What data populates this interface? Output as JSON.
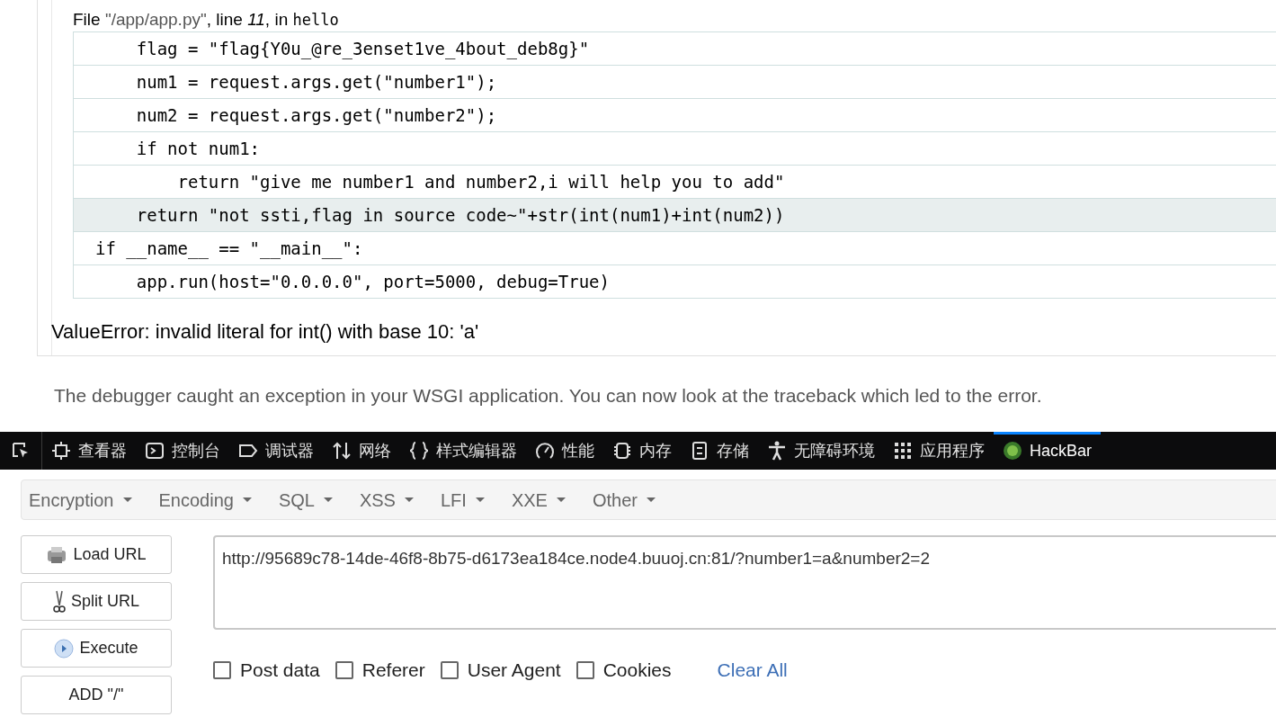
{
  "traceback": {
    "file_line": {
      "prefix": "File ",
      "path": "\"/app/app.py\"",
      "mid": ", line ",
      "line": "11",
      "sep": ", in ",
      "func": "hello"
    },
    "code_lines": [
      {
        "text": "    flag = \"flag{Y0u_@re_3enset1ve_4bout_deb8g}\"",
        "current": false
      },
      {
        "text": "    num1 = request.args.get(\"number1\");",
        "current": false
      },
      {
        "text": "    num2 = request.args.get(\"number2\");",
        "current": false
      },
      {
        "text": "    if not num1:",
        "current": false
      },
      {
        "text": "        return \"give me number1 and number2,i will help you to add\"",
        "current": false
      },
      {
        "text": "    return \"not ssti,flag in source code~\"+str(int(num1)+int(num2))",
        "current": true
      },
      {
        "text": "if __name__ == \"__main__\":",
        "current": false
      },
      {
        "text": "    app.run(host=\"0.0.0.0\", port=5000, debug=True)",
        "current": false
      }
    ],
    "error": "ValueError: invalid literal for int() with base 10: 'a'"
  },
  "explanation": "The debugger caught an exception in your WSGI application. You can now look at the traceback which led to the error.",
  "devtools_tabs": [
    {
      "kind": "picker"
    },
    {
      "kind": "inspector",
      "label": "查看器",
      "selected": false
    },
    {
      "kind": "console",
      "label": "控制台",
      "selected": false
    },
    {
      "kind": "debugger",
      "label": "调试器",
      "selected": false
    },
    {
      "kind": "network",
      "label": "网络",
      "selected": false
    },
    {
      "kind": "style",
      "label": "样式编辑器",
      "selected": false
    },
    {
      "kind": "performance",
      "label": "性能",
      "selected": false
    },
    {
      "kind": "memory",
      "label": "内存",
      "selected": false
    },
    {
      "kind": "storage",
      "label": "存储",
      "selected": false
    },
    {
      "kind": "accessibility",
      "label": "无障碍环境",
      "selected": false
    },
    {
      "kind": "application",
      "label": "应用程序",
      "selected": false
    },
    {
      "kind": "hackbar",
      "label": "HackBar",
      "selected": true
    }
  ],
  "hackbar": {
    "menus": [
      "Encryption",
      "Encoding",
      "SQL",
      "XSS",
      "LFI",
      "XXE",
      "Other"
    ],
    "buttons": [
      {
        "kind": "load",
        "label": "Load URL"
      },
      {
        "kind": "split",
        "label": "Split URL"
      },
      {
        "kind": "execute",
        "label": "Execute"
      },
      {
        "kind": "plain",
        "label": "ADD \"/\""
      }
    ],
    "url": "http://95689c78-14de-46f8-8b75-d6173ea184ce.node4.buuoj.cn:81/?number1=a&number2=2",
    "options": [
      {
        "label": "Post data",
        "checked": false
      },
      {
        "label": "Referer",
        "checked": false
      },
      {
        "label": "User Agent",
        "checked": false
      },
      {
        "label": "Cookies",
        "checked": false
      }
    ],
    "clear": "Clear All"
  }
}
